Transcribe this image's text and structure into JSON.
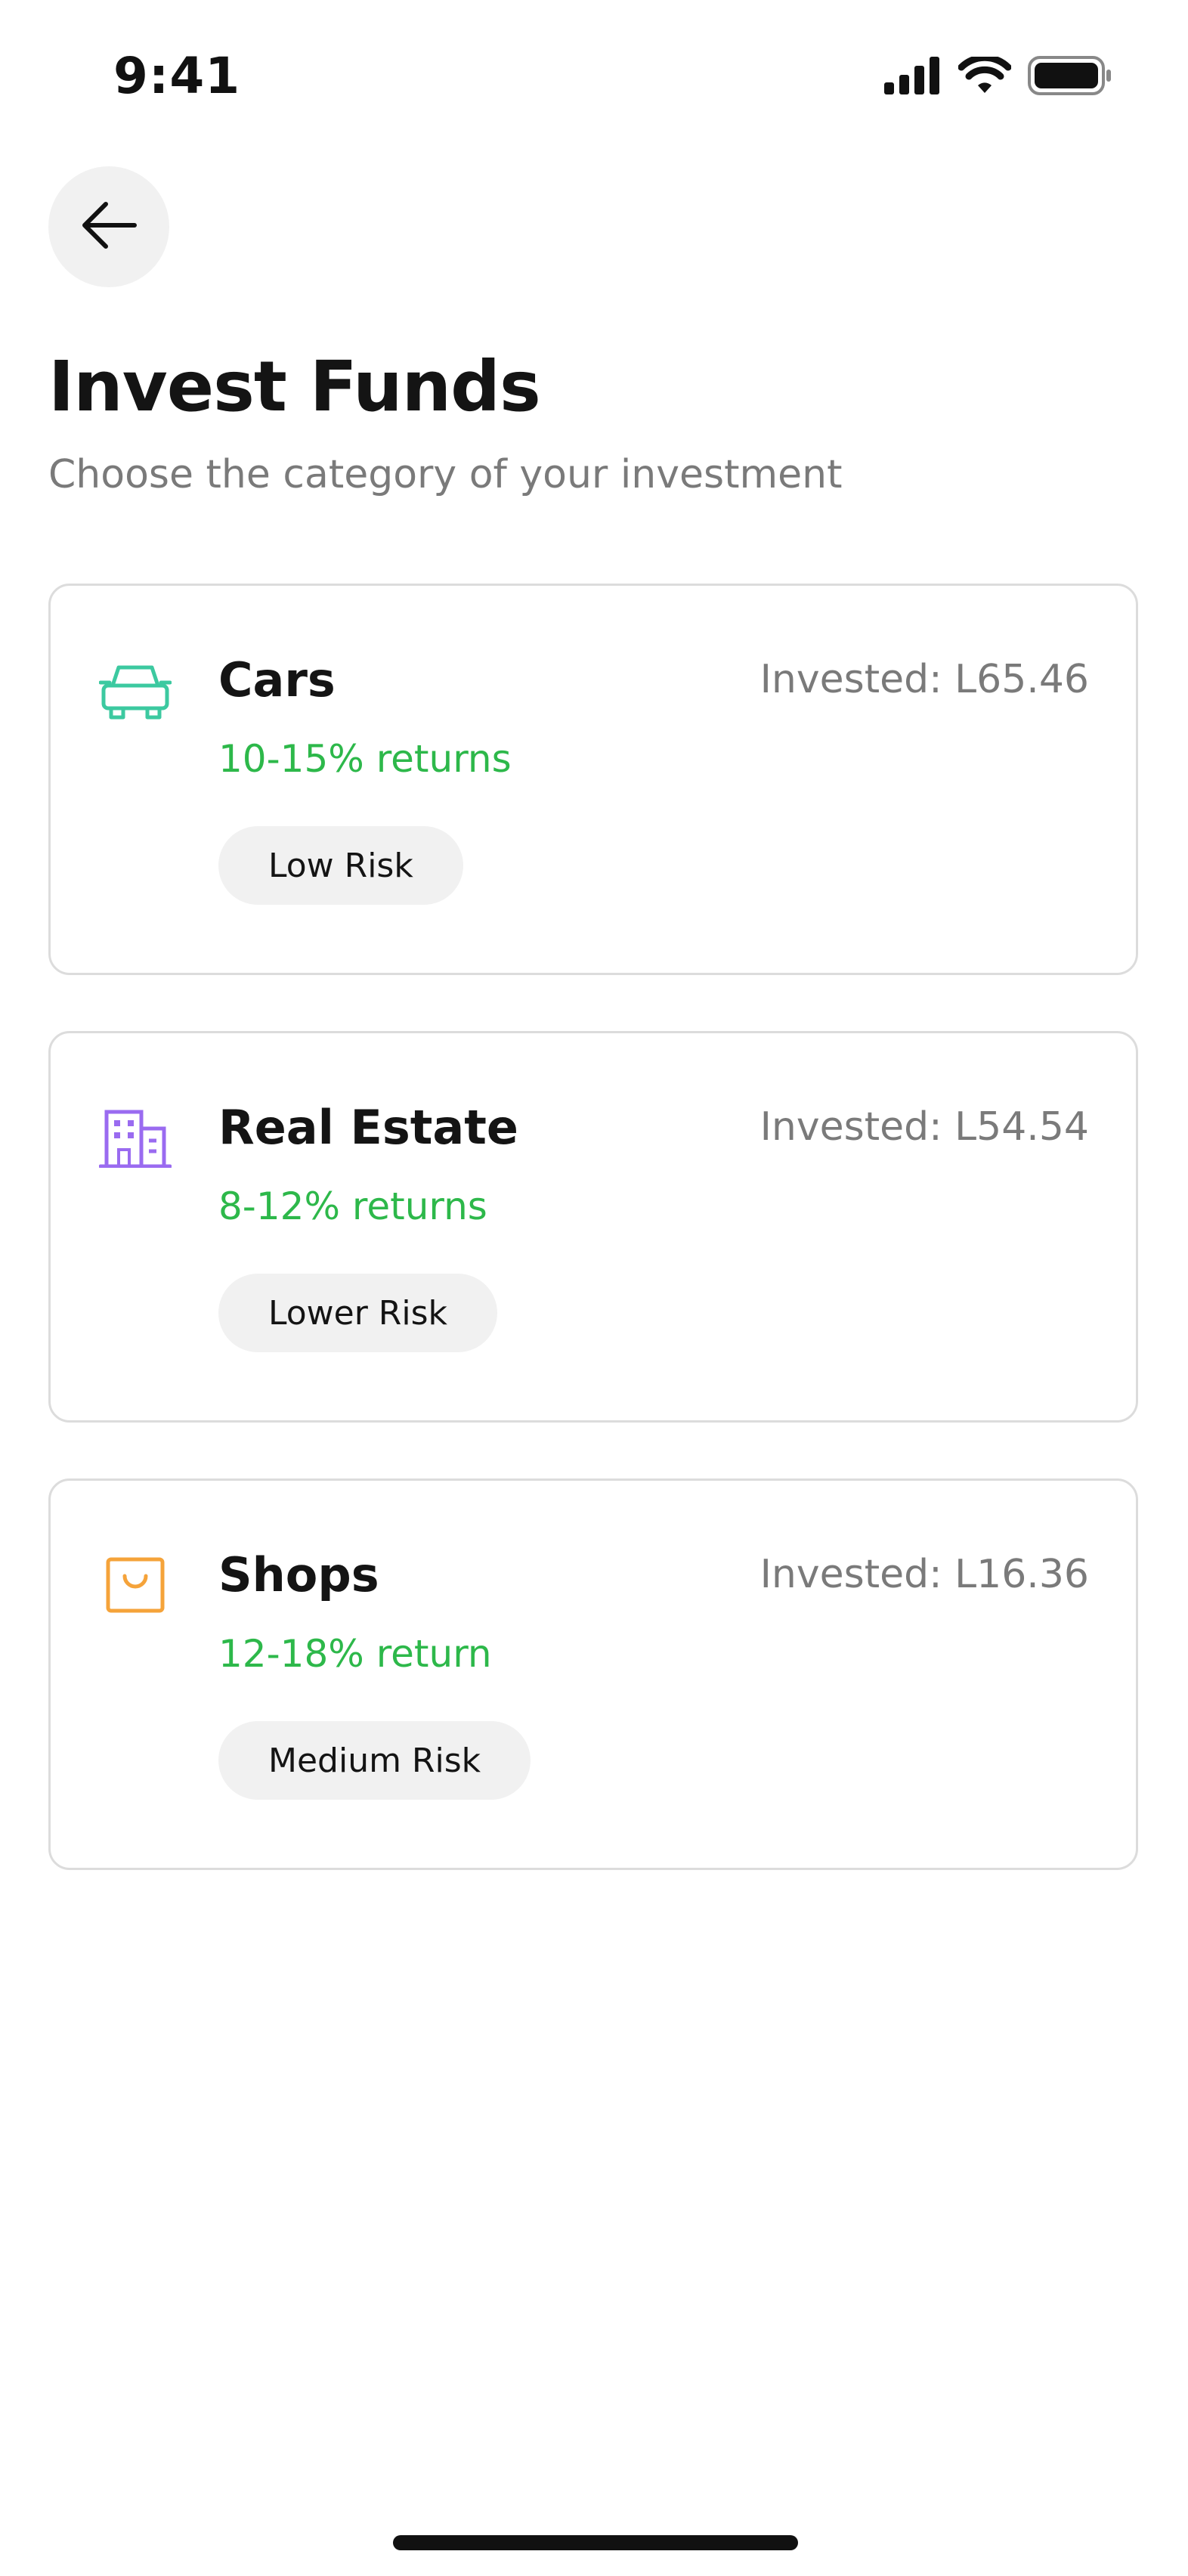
{
  "status_bar": {
    "time": "9:41"
  },
  "header": {
    "back_icon": "arrow-left-icon",
    "title": "Invest Funds",
    "subtitle": "Choose the category of your investment"
  },
  "categories": [
    {
      "name": "Cars",
      "icon": "car-icon",
      "icon_color": "#3cc9a0",
      "returns": "10-15% returns",
      "invested": "Invested: L65.46",
      "risk": "Low Risk"
    },
    {
      "name": "Real Estate",
      "icon": "building-icon",
      "icon_color": "#9a6bf0",
      "returns": "8-12% returns",
      "invested": "Invested: L54.54",
      "risk": "Lower Risk"
    },
    {
      "name": "Shops",
      "icon": "shopping-bag-icon",
      "icon_color": "#f5a33a",
      "returns": "12-18% return",
      "invested": "Invested: L16.36",
      "risk": "Medium Risk"
    }
  ],
  "colors": {
    "returns_green": "#2db84a",
    "muted_text": "#7a7a7a",
    "badge_bg": "#f1f1f1"
  }
}
